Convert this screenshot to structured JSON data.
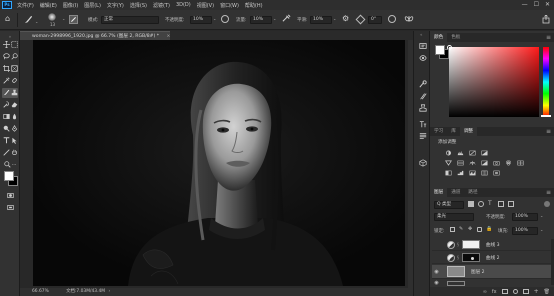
{
  "app": {
    "logo": "Ps"
  },
  "menu": [
    "文件(F)",
    "编辑(E)",
    "图像(I)",
    "图层(L)",
    "文字(Y)",
    "选择(S)",
    "滤镜(T)",
    "3D(D)",
    "视图(V)",
    "窗口(W)",
    "帮助(H)"
  ],
  "window_controls": {
    "minimize": "—",
    "maximize": "☐",
    "close": "✕"
  },
  "options": {
    "brush_size": "13",
    "mode_label": "模式:",
    "mode_value": "正常",
    "opacity_label": "不透明度:",
    "opacity_value": "10%",
    "flow_label": "流量:",
    "flow_value": "10%",
    "smooth_label": "平滑:",
    "smooth_value": "10%",
    "angle_value": "0°"
  },
  "document": {
    "tab_title": "woman-2998996_1920.jpg @ 66.7% (图层 2, RGB/8#) *",
    "close": "×",
    "zoom": "66.67%",
    "doc_info": "文档:7.03M/43.4M"
  },
  "color_panel": {
    "tabs": [
      "颜色",
      "色板"
    ]
  },
  "adjust_panel": {
    "tabs": [
      "学习",
      "库",
      "调整"
    ],
    "title": "添加调整"
  },
  "layers_panel": {
    "tabs": [
      "图层",
      "通道",
      "路径"
    ],
    "kind_label": "Q 类型",
    "blend_mode": "柔光",
    "opacity_label": "不透明度:",
    "opacity_value": "100%",
    "lock_label": "锁定:",
    "fill_label": "填充:",
    "fill_value": "100%",
    "layers": [
      {
        "name": "曲线 3",
        "visible": false,
        "thumb": "white"
      },
      {
        "name": "曲线 2",
        "visible": false,
        "thumb": "dark"
      },
      {
        "name": "图层 2",
        "visible": true,
        "thumb": "gray",
        "selected": true
      }
    ]
  },
  "colors": {
    "accent": "#31a8ff",
    "panel_bg": "#323232",
    "selection": "#4a4a4a",
    "red": "#ff1a1a"
  }
}
